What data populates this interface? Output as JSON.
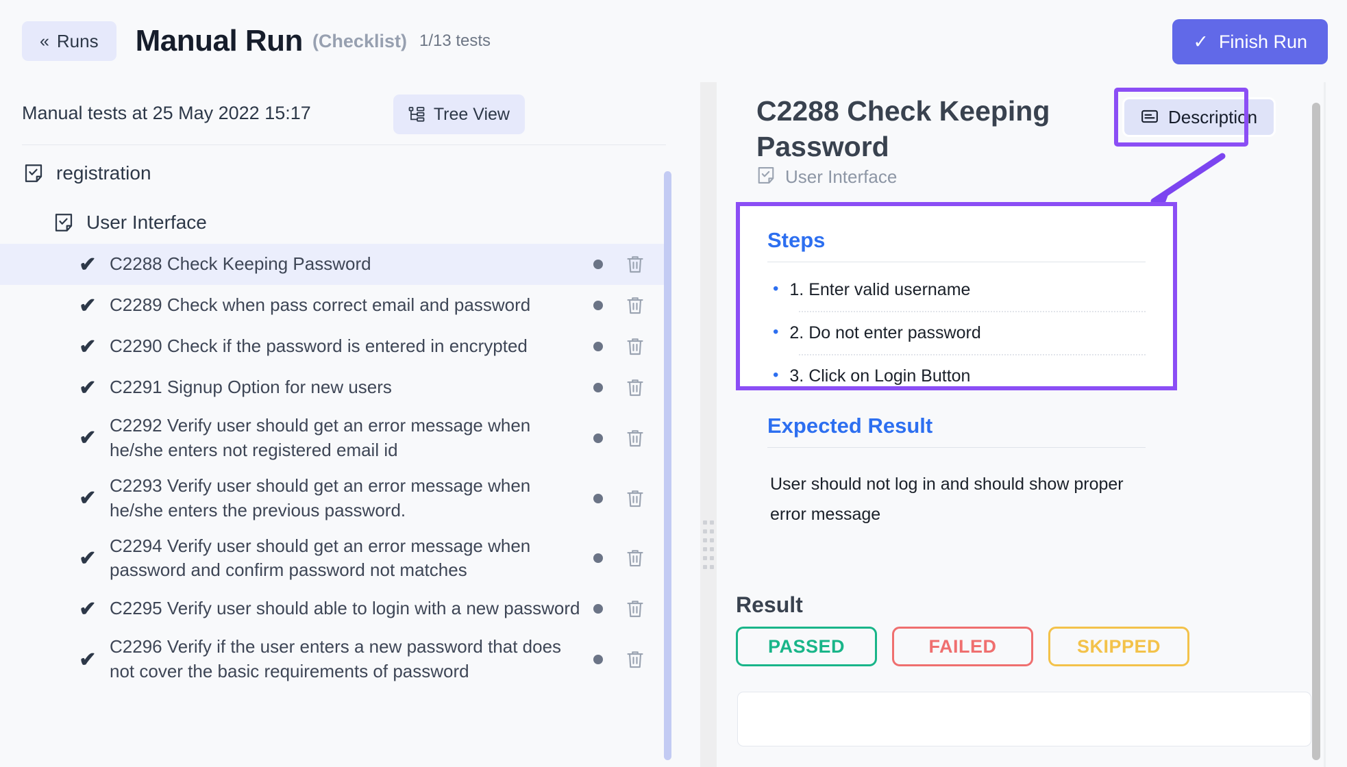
{
  "header": {
    "back_chevrons": "«",
    "back_label": "Runs",
    "title": "Manual Run",
    "subtitle": "(Checklist)",
    "count": "1/13 tests",
    "finish_check": "✓",
    "finish_label": "Finish Run"
  },
  "left_panel": {
    "heading": "Manual tests at 25 May 2022 15:17",
    "tree_view_label": "Tree View",
    "tree": {
      "root_folder": "registration",
      "sub_folder": "User Interface",
      "tests": [
        {
          "label": "C2288 Check Keeping Password",
          "check": "✔",
          "selected": true
        },
        {
          "label": "C2289 Check when pass correct email and password",
          "check": "✔",
          "selected": false
        },
        {
          "label": "C2290 Check if the password is entered in encrypted",
          "check": "✔",
          "selected": false
        },
        {
          "label": "C2291 Signup Option for new users",
          "check": "✔",
          "selected": false
        },
        {
          "label": "C2292 Verify user should get an error message when he/she enters not registered email id",
          "check": "✔",
          "selected": false
        },
        {
          "label": "C2293 Verify user should get an error message when he/she enters the previous password.",
          "check": "✔",
          "selected": false
        },
        {
          "label": "C2294 Verify user should get an error message when password and confirm password not matches",
          "check": "✔",
          "selected": false
        },
        {
          "label": "C2295 Verify user should able to login with a new password",
          "check": "✔",
          "selected": false
        },
        {
          "label": "C2296 Verify if the user enters a new password that does not cover the basic requirements of password",
          "check": "✔",
          "selected": false
        }
      ]
    }
  },
  "right_panel": {
    "test_title": "C2288 Check Keeping Password",
    "suite_label": "User Interface",
    "description_tab_label": "Description",
    "steps_heading": "Steps",
    "steps": [
      "1. Enter valid username",
      "2. Do not enter password",
      "3. Click on Login Button"
    ],
    "step_bullet": "•",
    "expected_heading": "Expected Result",
    "expected_text": "User should not log in and should show proper error message",
    "result_heading": "Result",
    "result_buttons": [
      {
        "label": "PASSED",
        "color": "#19b589"
      },
      {
        "label": "FAILED",
        "color": "#ef6f6f"
      },
      {
        "label": "SKIPPED",
        "color": "#f3c24a"
      }
    ]
  },
  "colors": {
    "accent": "#6169e8",
    "annotation": "#8b4ef5",
    "section_heading": "#2d6ff0",
    "selected_row": "#ebeefc"
  }
}
